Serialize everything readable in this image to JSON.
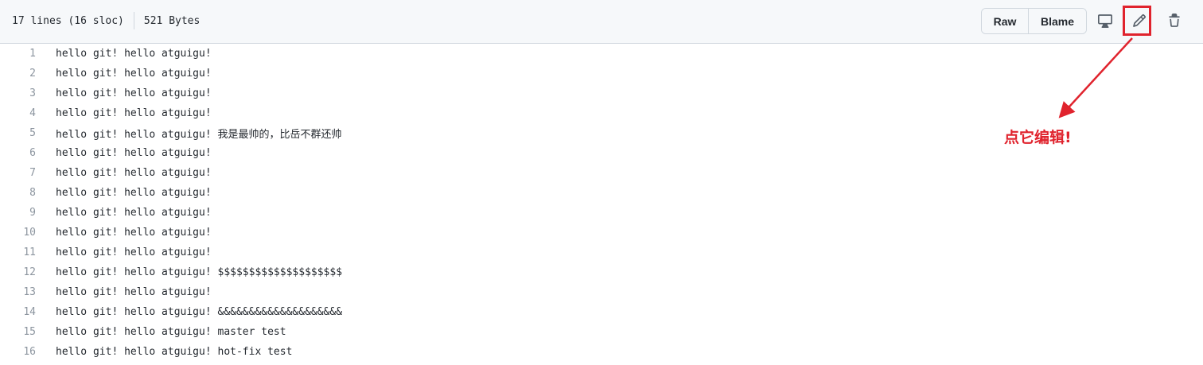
{
  "file_header": {
    "lines_info": "17 lines (16 sloc)",
    "size_info": "521 Bytes",
    "raw_label": "Raw",
    "blame_label": "Blame",
    "icons": [
      "desktop-icon",
      "pencil-icon",
      "trash-icon"
    ]
  },
  "code_lines": [
    {
      "num": "1",
      "text": "hello git! hello atguigu!"
    },
    {
      "num": "2",
      "text": "hello git! hello atguigu!"
    },
    {
      "num": "3",
      "text": "hello git! hello atguigu!"
    },
    {
      "num": "4",
      "text": "hello git! hello atguigu!"
    },
    {
      "num": "5",
      "text": "hello git! hello atguigu! 我是最帅的，比岳不群还帅"
    },
    {
      "num": "6",
      "text": "hello git! hello atguigu!"
    },
    {
      "num": "7",
      "text": "hello git! hello atguigu!"
    },
    {
      "num": "8",
      "text": "hello git! hello atguigu!"
    },
    {
      "num": "9",
      "text": "hello git! hello atguigu!"
    },
    {
      "num": "10",
      "text": "hello git! hello atguigu!"
    },
    {
      "num": "11",
      "text": "hello git! hello atguigu!"
    },
    {
      "num": "12",
      "text": "hello git! hello atguigu! $$$$$$$$$$$$$$$$$$$$"
    },
    {
      "num": "13",
      "text": "hello git! hello atguigu!"
    },
    {
      "num": "14",
      "text": "hello git! hello atguigu! &&&&&&&&&&&&&&&&&&&&"
    },
    {
      "num": "15",
      "text": "hello git! hello atguigu! master test"
    },
    {
      "num": "16",
      "text": "hello git! hello atguigu! hot-fix test"
    }
  ],
  "annotation": {
    "text": "点它编辑!",
    "color": "#e0232d"
  },
  "colors": {
    "header_bg": "#f6f8fa",
    "border": "#d0d7de",
    "line_number": "#8c959f",
    "text": "#24292f"
  }
}
